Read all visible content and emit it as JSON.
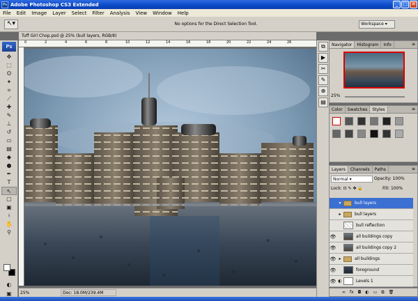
{
  "app": {
    "title": "Adobe Photoshop CS3 Extended"
  },
  "menu": [
    "File",
    "Edit",
    "Image",
    "Layer",
    "Select",
    "Filter",
    "Analysis",
    "View",
    "Window",
    "Help"
  ],
  "options": {
    "message": "No options for the Direct Selection Tool.",
    "workspace": "Workspace"
  },
  "document": {
    "tab": "Tuff Girl Chop.psd @ 25% (bull layers, RGB/8)"
  },
  "ruler": [
    "0",
    "2",
    "4",
    "6",
    "8",
    "10",
    "12",
    "14",
    "16",
    "18",
    "20",
    "22",
    "24",
    "26"
  ],
  "status": {
    "zoom": "25%",
    "doc": "Doc: 18.0M/239.4M"
  },
  "navigator": {
    "tabs": [
      "Navigator",
      "Histogram",
      "Info"
    ],
    "zoom": "25%"
  },
  "color_panel": {
    "tabs": [
      "Color",
      "Swatches",
      "Styles"
    ]
  },
  "layers_panel": {
    "tabs": [
      "Layers",
      "Channels",
      "Paths"
    ],
    "blend_mode": "Normal",
    "opacity_label": "Opacity:",
    "opacity": "100%",
    "lock_label": "Lock:",
    "fill_label": "Fill:",
    "fill": "100%",
    "layers": [
      {
        "name": "bull layers",
        "type": "folder",
        "selected": true,
        "visible": false
      },
      {
        "name": "bull layers",
        "type": "folder",
        "selected": false,
        "visible": false
      },
      {
        "name": "bull reflection",
        "type": "layer",
        "selected": false,
        "visible": false
      },
      {
        "name": "all buildings copy",
        "type": "layer",
        "selected": false,
        "visible": true
      },
      {
        "name": "all buildings copy 2",
        "type": "layer",
        "selected": false,
        "visible": true
      },
      {
        "name": "all buildings",
        "type": "folder",
        "selected": false,
        "visible": true
      },
      {
        "name": "foreground",
        "type": "layer",
        "selected": false,
        "visible": true
      },
      {
        "name": "Levels 1",
        "type": "adjustment",
        "selected": false,
        "visible": true
      }
    ]
  }
}
